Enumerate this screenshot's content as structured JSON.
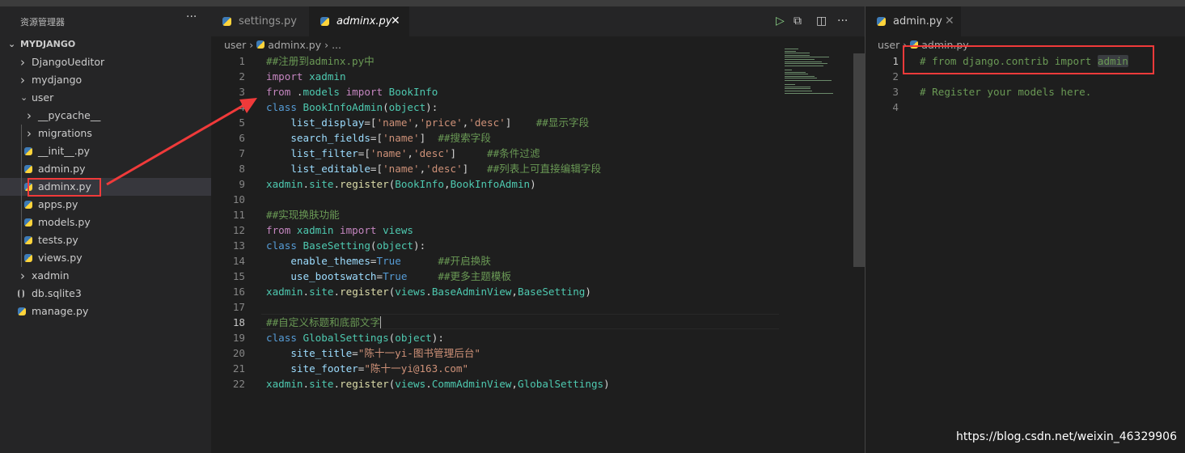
{
  "sidebar": {
    "title": "资源管理器",
    "more": "···",
    "items": [
      {
        "label": "MYDJANGO",
        "type": "root",
        "open": true,
        "level": 0
      },
      {
        "label": "DjangoUeditor",
        "type": "folder",
        "level": 1
      },
      {
        "label": "mydjango",
        "type": "folder",
        "level": 1
      },
      {
        "label": "user",
        "type": "folder",
        "open": true,
        "level": 1
      },
      {
        "label": "__pycache__",
        "type": "folder",
        "level": 2
      },
      {
        "label": "migrations",
        "type": "folder",
        "level": 2
      },
      {
        "label": "__init__.py",
        "type": "py",
        "level": 2
      },
      {
        "label": "admin.py",
        "type": "py",
        "level": 2
      },
      {
        "label": "adminx.py",
        "type": "py",
        "level": 2,
        "selected": true
      },
      {
        "label": "apps.py",
        "type": "py",
        "level": 2
      },
      {
        "label": "models.py",
        "type": "py",
        "level": 2
      },
      {
        "label": "tests.py",
        "type": "py",
        "level": 2
      },
      {
        "label": "views.py",
        "type": "py",
        "level": 2
      },
      {
        "label": "xadmin",
        "type": "folder",
        "level": 1
      },
      {
        "label": "db.sqlite3",
        "type": "db",
        "level": 1
      },
      {
        "label": "manage.py",
        "type": "py",
        "level": 1
      }
    ]
  },
  "left_editor": {
    "tabs": [
      {
        "label": "settings.py",
        "active": false
      },
      {
        "label": "adminx.py",
        "active": true
      }
    ],
    "close": "✕",
    "actions": {
      "run": "▷",
      "preview": "⧉",
      "split": "◫",
      "more": "···"
    },
    "breadcrumb": {
      "folder": "user",
      "file": "adminx.py",
      "rest": "..."
    },
    "current_line": 18,
    "lines": [
      [
        [
          "##注册到adminx.py中",
          "c"
        ]
      ],
      [
        [
          "import",
          "k"
        ],
        [
          " xadmin",
          "t"
        ]
      ],
      [
        [
          "from",
          "k"
        ],
        [
          " .",
          "d"
        ],
        [
          "models",
          "t"
        ],
        [
          " import",
          "k"
        ],
        [
          " BookInfo",
          "t"
        ]
      ],
      [
        [
          "class",
          "b"
        ],
        [
          " BookInfoAdmin",
          "t"
        ],
        [
          "(",
          "d"
        ],
        [
          "object",
          "t"
        ],
        [
          "):",
          "d"
        ]
      ],
      [
        [
          "    list_display",
          "v"
        ],
        [
          "=[",
          "d"
        ],
        [
          "'name'",
          "s"
        ],
        [
          ",",
          "d"
        ],
        [
          "'price'",
          "s"
        ],
        [
          ",",
          "d"
        ],
        [
          "'desc'",
          "s"
        ],
        [
          "]    ",
          "d"
        ],
        [
          "##显示字段",
          "c"
        ]
      ],
      [
        [
          "    search_fields",
          "v"
        ],
        [
          "=[",
          "d"
        ],
        [
          "'name'",
          "s"
        ],
        [
          "]  ",
          "d"
        ],
        [
          "##搜索字段",
          "c"
        ]
      ],
      [
        [
          "    list_filter",
          "v"
        ],
        [
          "=[",
          "d"
        ],
        [
          "'name'",
          "s"
        ],
        [
          ",",
          "d"
        ],
        [
          "'desc'",
          "s"
        ],
        [
          "]     ",
          "d"
        ],
        [
          "##条件过滤",
          "c"
        ]
      ],
      [
        [
          "    list_editable",
          "v"
        ],
        [
          "=[",
          "d"
        ],
        [
          "'name'",
          "s"
        ],
        [
          ",",
          "d"
        ],
        [
          "'desc'",
          "s"
        ],
        [
          "]   ",
          "d"
        ],
        [
          "##列表上可直接编辑字段",
          "c"
        ]
      ],
      [
        [
          "xadmin",
          "t"
        ],
        [
          ".",
          "d"
        ],
        [
          "site",
          "t"
        ],
        [
          ".",
          "d"
        ],
        [
          "register",
          "f"
        ],
        [
          "(",
          "d"
        ],
        [
          "BookInfo",
          "t"
        ],
        [
          ",",
          "d"
        ],
        [
          "BookInfoAdmin",
          "t"
        ],
        [
          ")",
          "d"
        ]
      ],
      [],
      [
        [
          "##实现换肤功能",
          "c"
        ]
      ],
      [
        [
          "from",
          "k"
        ],
        [
          " xadmin",
          "t"
        ],
        [
          " import",
          "k"
        ],
        [
          " views",
          "t"
        ]
      ],
      [
        [
          "class",
          "b"
        ],
        [
          " BaseSetting",
          "t"
        ],
        [
          "(",
          "d"
        ],
        [
          "object",
          "t"
        ],
        [
          "):",
          "d"
        ]
      ],
      [
        [
          "    enable_themes",
          "v"
        ],
        [
          "=",
          "d"
        ],
        [
          "True",
          "b"
        ],
        [
          "      ",
          "d"
        ],
        [
          "##开启换肤",
          "c"
        ]
      ],
      [
        [
          "    use_bootswatch",
          "v"
        ],
        [
          "=",
          "d"
        ],
        [
          "True",
          "b"
        ],
        [
          "     ",
          "d"
        ],
        [
          "##更多主题模板",
          "c"
        ]
      ],
      [
        [
          "xadmin",
          "t"
        ],
        [
          ".",
          "d"
        ],
        [
          "site",
          "t"
        ],
        [
          ".",
          "d"
        ],
        [
          "register",
          "f"
        ],
        [
          "(",
          "d"
        ],
        [
          "views",
          "t"
        ],
        [
          ".",
          "d"
        ],
        [
          "BaseAdminView",
          "t"
        ],
        [
          ",",
          "d"
        ],
        [
          "BaseSetting",
          "t"
        ],
        [
          ")",
          "d"
        ]
      ],
      [],
      [
        [
          "##自定义标题和底部文字",
          "c"
        ]
      ],
      [
        [
          "class",
          "b"
        ],
        [
          " GlobalSettings",
          "t"
        ],
        [
          "(",
          "d"
        ],
        [
          "object",
          "t"
        ],
        [
          "):",
          "d"
        ]
      ],
      [
        [
          "    site_title",
          "v"
        ],
        [
          "=",
          "d"
        ],
        [
          "\"陈十一yi-图书管理后台\"",
          "s"
        ]
      ],
      [
        [
          "    site_footer",
          "v"
        ],
        [
          "=",
          "d"
        ],
        [
          "\"陈十一yi@163.com\"",
          "s"
        ]
      ],
      [
        [
          "xadmin",
          "t"
        ],
        [
          ".",
          "d"
        ],
        [
          "site",
          "t"
        ],
        [
          ".",
          "d"
        ],
        [
          "register",
          "f"
        ],
        [
          "(",
          "d"
        ],
        [
          "views",
          "t"
        ],
        [
          ".",
          "d"
        ],
        [
          "CommAdminView",
          "t"
        ],
        [
          ",",
          "d"
        ],
        [
          "GlobalSettings",
          "t"
        ],
        [
          ")",
          "d"
        ]
      ]
    ]
  },
  "right_editor": {
    "tab": {
      "label": "admin.py",
      "close": "✕"
    },
    "breadcrumb": {
      "folder": "user",
      "file": "admin.py"
    },
    "current_line": 1,
    "lines": [
      [
        [
          "# from django.contrib import ",
          "c"
        ],
        [
          "admin",
          "c"
        ]
      ],
      [],
      [
        [
          "# Register your models here.",
          "c"
        ]
      ],
      []
    ]
  },
  "watermark": "https://blog.csdn.net/weixin_46329906",
  "colors": {
    "annotation": "#f03a3a",
    "comment": "#6a9955",
    "keyword": "#c586c0",
    "type": "#4ec9b0",
    "string": "#ce9178"
  }
}
